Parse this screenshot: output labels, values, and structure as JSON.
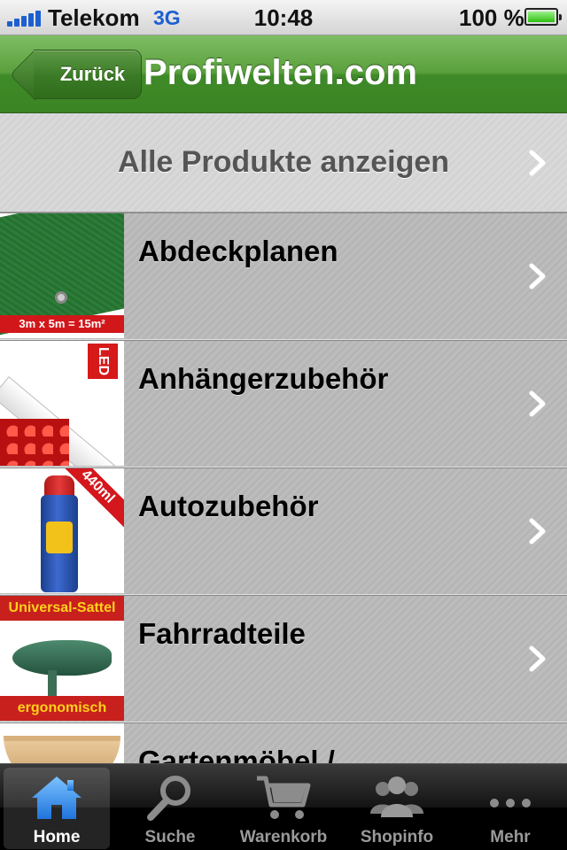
{
  "status_bar": {
    "carrier": "Telekom",
    "network": "3G",
    "time": "10:48",
    "battery": "100 %"
  },
  "nav_bar": {
    "back_label": "Zurück",
    "title": "Profiwelten.com"
  },
  "list": {
    "all_products_label": "Alle Produkte anzeigen",
    "categories": [
      {
        "label": "Abdeckplanen",
        "thumb_text": "3m x 5m = 15m²"
      },
      {
        "label": "Anhängerzubehör",
        "thumb_text": "LED"
      },
      {
        "label": "Autozubehör",
        "thumb_text": "440ml"
      },
      {
        "label": "Fahrradteile",
        "thumb_text_top": "Universal-Sattel",
        "thumb_text_bottom": "ergonomisch"
      },
      {
        "label": "Gartenmöbel /"
      }
    ]
  },
  "tab_bar": {
    "tabs": [
      {
        "label": "Home",
        "icon": "home-icon",
        "active": true
      },
      {
        "label": "Suche",
        "icon": "search-icon"
      },
      {
        "label": "Warenkorb",
        "icon": "cart-icon"
      },
      {
        "label": "Shopinfo",
        "icon": "people-icon"
      },
      {
        "label": "Mehr",
        "icon": "more-icon"
      }
    ]
  },
  "colors": {
    "nav_green": "#4f9636",
    "status_blue": "#1d5fd0",
    "home_icon_blue": "#3a93f0"
  }
}
